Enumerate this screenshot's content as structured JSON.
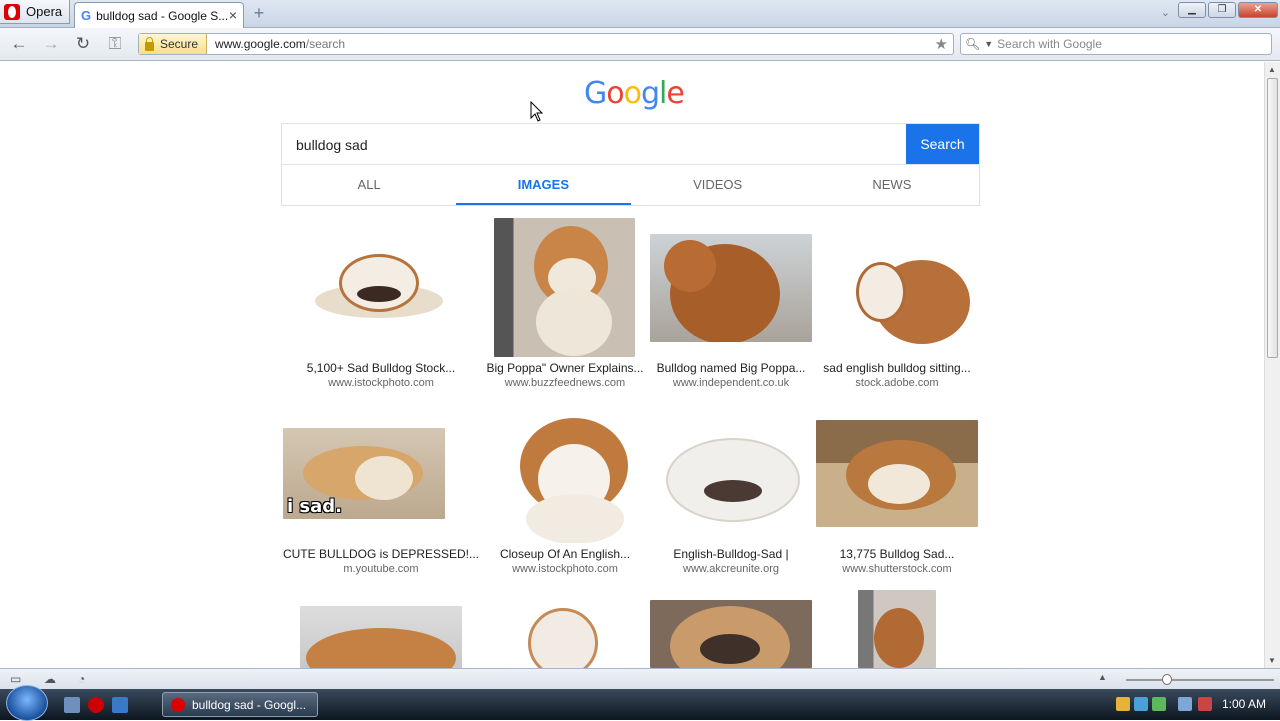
{
  "browser": {
    "menu_label": "Opera",
    "tab_title": "bulldog sad - Google S...",
    "security_label": "Secure",
    "url_host": "www.google.com",
    "url_path": "/search",
    "search_placeholder": "Search with Google"
  },
  "page": {
    "logo": [
      "G",
      "o",
      "o",
      "g",
      "l",
      "e"
    ],
    "logo_colors": [
      "#4285f4",
      "#ea4335",
      "#fbbc05",
      "#4285f4",
      "#34a853",
      "#ea4335"
    ],
    "query": "bulldog sad",
    "search_button": "Search",
    "tabs": [
      {
        "label": "ALL",
        "active": false
      },
      {
        "label": "IMAGES",
        "active": true
      },
      {
        "label": "VIDEOS",
        "active": false
      },
      {
        "label": "NEWS",
        "active": false
      }
    ],
    "results": [
      {
        "title": "5,100+ Sad Bulldog Stock...",
        "site": "www.istockphoto.com"
      },
      {
        "title": "Big Poppa\" Owner Explains...",
        "site": "www.buzzfeednews.com"
      },
      {
        "title": "Bulldog named Big Poppa...",
        "site": "www.independent.co.uk"
      },
      {
        "title": "sad english bulldog sitting...",
        "site": "stock.adobe.com"
      },
      {
        "title": "CUTE BULLDOG is DEPRESSED!...",
        "site": "m.youtube.com"
      },
      {
        "title": "Closeup Of An English...",
        "site": "www.istockphoto.com"
      },
      {
        "title": "English-Bulldog-Sad |",
        "site": "www.akcreunite.org"
      },
      {
        "title": "13,775 Bulldog Sad...",
        "site": "www.shutterstock.com"
      }
    ],
    "meme_text": "i sad."
  },
  "taskbar": {
    "app_label": "bulldog sad - Googl...",
    "clock": "1:00 AM"
  }
}
